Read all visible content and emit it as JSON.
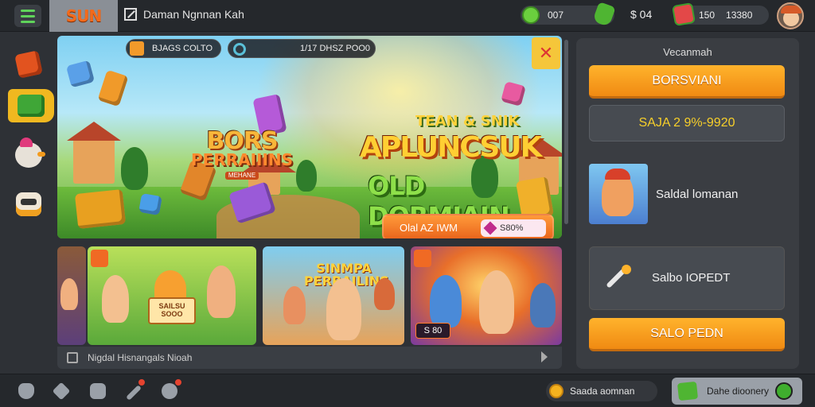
{
  "topbar": {
    "logo": "SUN",
    "title": "Daman Ngnnan Kah",
    "coins": "007",
    "cash": "$ 04",
    "gems_a": "150",
    "gems_b": "13380"
  },
  "banner": {
    "pill_left": "BJAGS COLTO",
    "pill_mid": "1/17 DHSZ POO0",
    "game_logo_line1": "BORS",
    "game_logo_line2": "PERRAIIINS",
    "game_logo_line3": "MEHANE",
    "tagline": "TEAN & SNIK",
    "headline": "APLUNCSUK",
    "subheadline": "OLD DORMIAIN",
    "cta_label": "Olal AZ IWM",
    "cta_price": "S80%"
  },
  "thumbnails": [
    {
      "sign": "SAILSU SOOO"
    },
    {
      "logo": "SINMPA PERRAILINS"
    },
    {
      "tag": "S 80"
    }
  ],
  "footer": {
    "text": "Nigdal Hisnangals Nioah"
  },
  "panel": {
    "title": "Vecanmah",
    "primary_button": "BORSVIANI",
    "code": "SAJA 2 9%-9920",
    "item1_label": "Saldal lomanan",
    "item2_label": "Salbo IOPEDT",
    "secondary_button": "SALO PEDN"
  },
  "bottom": {
    "balance_label": "Saada aomnan",
    "status_label": "Dahe dioonery"
  },
  "colors": {
    "accent_orange": "#f08a12",
    "accent_green": "#4fb532",
    "code_yellow": "#f7cf2a"
  }
}
